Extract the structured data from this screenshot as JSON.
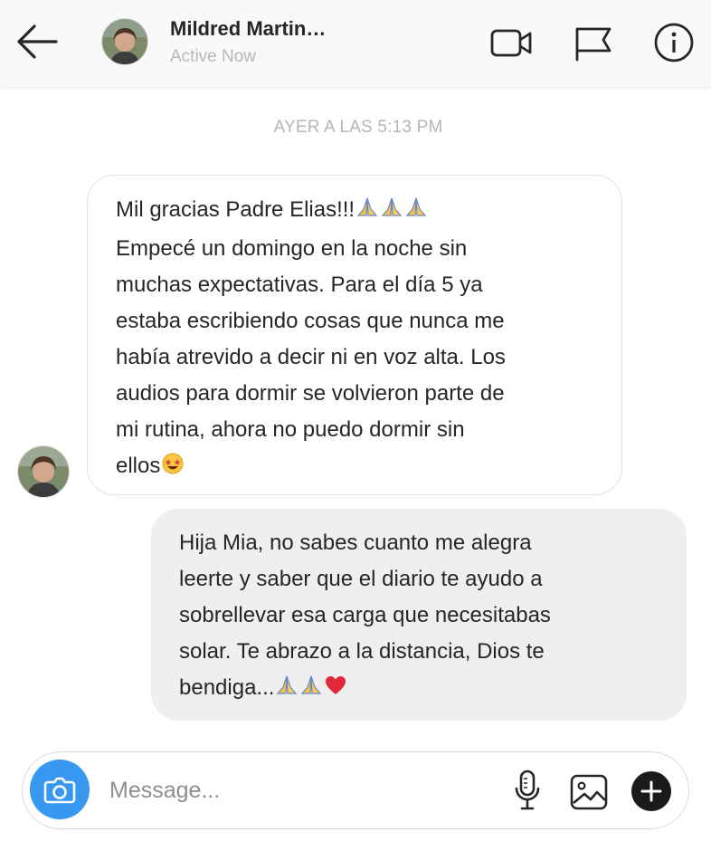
{
  "header": {
    "contact_name": "Mildred Martin…",
    "status": "Active Now",
    "icons": {
      "back": "arrow-left-icon",
      "video": "video-camera-icon",
      "flag": "flag-icon",
      "info": "info-icon"
    }
  },
  "thread": {
    "timestamp": "AYER A LAS 5:13 PM",
    "messages": [
      {
        "direction": "incoming",
        "lines": [
          "Mil gracias Padre Elias!!!",
          "Empecé un domingo en la noche sin",
          "muchas expectativas. Para el día 5 ya",
          "estaba escribiendo cosas que nunca me",
          "había atrevido a decir ni en voz alta. Los",
          "audios para dormir se volvieron parte de",
          "mi rutina, ahora no puedo dormir sin",
          "ellos"
        ],
        "emojis": [
          "folded-hands",
          "folded-hands",
          "folded-hands",
          "star-struck"
        ]
      },
      {
        "direction": "outgoing",
        "lines": [
          "Hija Mia, no sabes cuanto me alegra",
          "leerte y saber que el diario te ayudo a",
          "sobrellevar esa carga que necesitabas",
          "solar. Te abrazo a la distancia, Dios te",
          "bendiga..."
        ],
        "emojis": [
          "folded-hands",
          "folded-hands",
          "red-heart"
        ]
      }
    ]
  },
  "composer": {
    "placeholder": "Message...",
    "icons": {
      "camera": "camera-icon",
      "mic": "microphone-icon",
      "gallery": "image-icon",
      "plus": "plus-circle-icon"
    }
  },
  "colors": {
    "accent_blue": "#3897f0",
    "outgoing_bubble": "#efefef",
    "header_bg": "#f9f9f9",
    "muted_text": "#b6b6b6"
  }
}
